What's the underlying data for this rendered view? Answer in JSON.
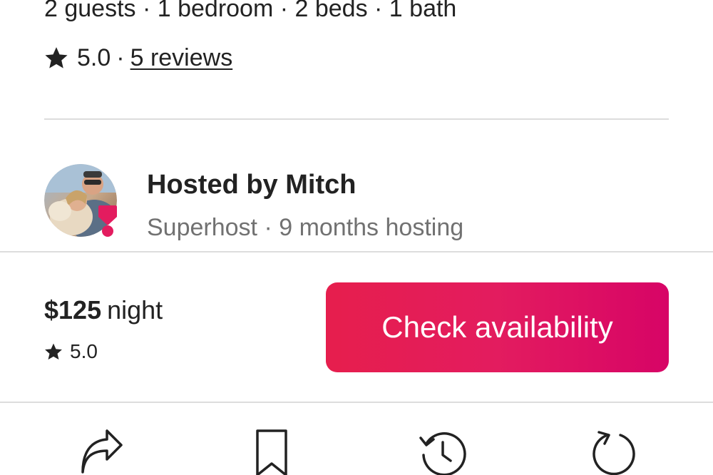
{
  "listing": {
    "summary": "2 guests · 1 bedroom · 2 beds · 1 bath",
    "rating": "5.0",
    "separator": "·",
    "reviews_link": "5 reviews"
  },
  "host": {
    "title": "Hosted by Mitch",
    "meta": "Superhost · 9 months hosting",
    "badge": "superhost-badge"
  },
  "booking": {
    "price": "$125",
    "price_unit": "night",
    "rating": "5.0",
    "cta_label": "Check availability"
  },
  "toolbar": {
    "items": [
      {
        "icon": "share-icon"
      },
      {
        "icon": "bookmark-icon"
      },
      {
        "icon": "history-icon"
      },
      {
        "icon": "reload-icon"
      }
    ]
  },
  "colors": {
    "accent_start": "#e61e4d",
    "accent_end": "#d70466",
    "text_primary": "#222222",
    "text_secondary": "#717171",
    "divider": "#dddddd"
  }
}
